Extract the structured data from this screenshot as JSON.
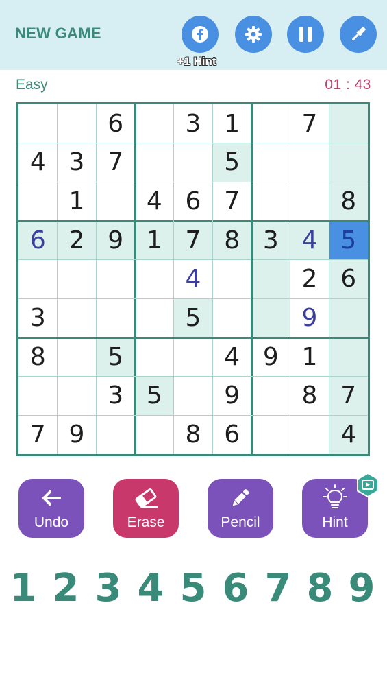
{
  "header": {
    "new_game_label": "NEW GAME",
    "facebook_hint_label": "+1 Hint",
    "accent_color": "#4a90e2"
  },
  "status": {
    "difficulty": "Easy",
    "timer": "01 : 43"
  },
  "board": {
    "cells": [
      [
        "",
        "",
        "6",
        "",
        "3",
        "1",
        "",
        "7",
        ""
      ],
      [
        "4",
        "3",
        "7",
        "",
        "",
        "5",
        "",
        "",
        ""
      ],
      [
        "",
        "1",
        "",
        "4",
        "6",
        "7",
        "",
        "",
        "8"
      ],
      [
        "6",
        "2",
        "9",
        "1",
        "7",
        "8",
        "3",
        "4",
        "5"
      ],
      [
        "",
        "",
        "",
        "",
        "4",
        "",
        "",
        "2",
        "6"
      ],
      [
        "3",
        "",
        "",
        "",
        "5",
        "",
        "",
        "9",
        ""
      ],
      [
        "8",
        "",
        "5",
        "",
        "",
        "4",
        "9",
        "1",
        ""
      ],
      [
        "",
        "",
        "3",
        "5",
        "",
        "9",
        "",
        "8",
        "7"
      ],
      [
        "7",
        "9",
        "",
        "",
        "8",
        "6",
        "",
        "",
        "4"
      ]
    ],
    "user_entered": [
      [
        3,
        0
      ],
      [
        3,
        7
      ],
      [
        4,
        4
      ],
      [
        5,
        7
      ]
    ],
    "highlighted": [
      [
        0,
        8
      ],
      [
        1,
        5
      ],
      [
        1,
        8
      ],
      [
        2,
        8
      ],
      [
        3,
        0
      ],
      [
        3,
        1
      ],
      [
        3,
        2
      ],
      [
        3,
        3
      ],
      [
        3,
        4
      ],
      [
        3,
        5
      ],
      [
        3,
        6
      ],
      [
        3,
        7
      ],
      [
        4,
        6
      ],
      [
        4,
        8
      ],
      [
        5,
        4
      ],
      [
        5,
        6
      ],
      [
        5,
        8
      ],
      [
        6,
        2
      ],
      [
        6,
        8
      ],
      [
        7,
        3
      ],
      [
        7,
        8
      ],
      [
        8,
        8
      ]
    ],
    "selected": [
      3,
      8
    ],
    "selected_color": "#4a90e2",
    "highlight_color": "#dcf0ec"
  },
  "actions": [
    {
      "label": "Undo",
      "icon": "undo-arrow-icon",
      "color": "#7b52b9"
    },
    {
      "label": "Erase",
      "icon": "eraser-icon",
      "color": "#c9386a"
    },
    {
      "label": "Pencil",
      "icon": "pencil-icon",
      "color": "#7b52b9"
    },
    {
      "label": "Hint",
      "icon": "lightbulb-icon",
      "color": "#7b52b9"
    }
  ],
  "numpad": [
    "1",
    "2",
    "3",
    "4",
    "5",
    "6",
    "7",
    "8",
    "9"
  ]
}
